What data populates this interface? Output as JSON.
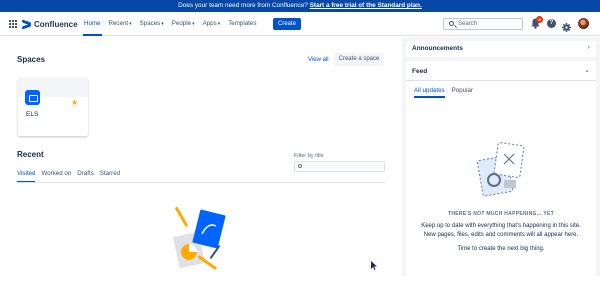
{
  "banner": {
    "text": "Does your team need more from Confluence? ",
    "link": "Start a free trial of the Standard plan."
  },
  "topnav": {
    "logo": "Confluence",
    "items": [
      "Home",
      "Recent",
      "Spaces",
      "People",
      "Apps",
      "Templates"
    ],
    "create_label": "Create",
    "search_placeholder": "Search",
    "notification_count": "4"
  },
  "spaces": {
    "heading": "Spaces",
    "view_all": "View all",
    "create_space": "Create a space",
    "cards": [
      {
        "name": "ELS"
      }
    ]
  },
  "recent": {
    "heading": "Recent",
    "filter_label": "Filter by title",
    "tabs": [
      "Visited",
      "Worked on",
      "Drafts",
      "Starred"
    ]
  },
  "right_panel": {
    "announcements": "Announcements",
    "feed": "Feed",
    "tabs": [
      "All updates",
      "Popular"
    ],
    "empty_title": "THERE'S NOT MUCH HAPPENING... YET",
    "empty_desc": "Keep up to date with everything that's happening in this site. New pages, files, edits and comments will all appear here.",
    "empty_foot": "Time to create the next big thing."
  },
  "colors": {
    "brand": "#0052cc",
    "banner": "#0747a6",
    "badge": "#de350b",
    "star": "#ffab00"
  }
}
